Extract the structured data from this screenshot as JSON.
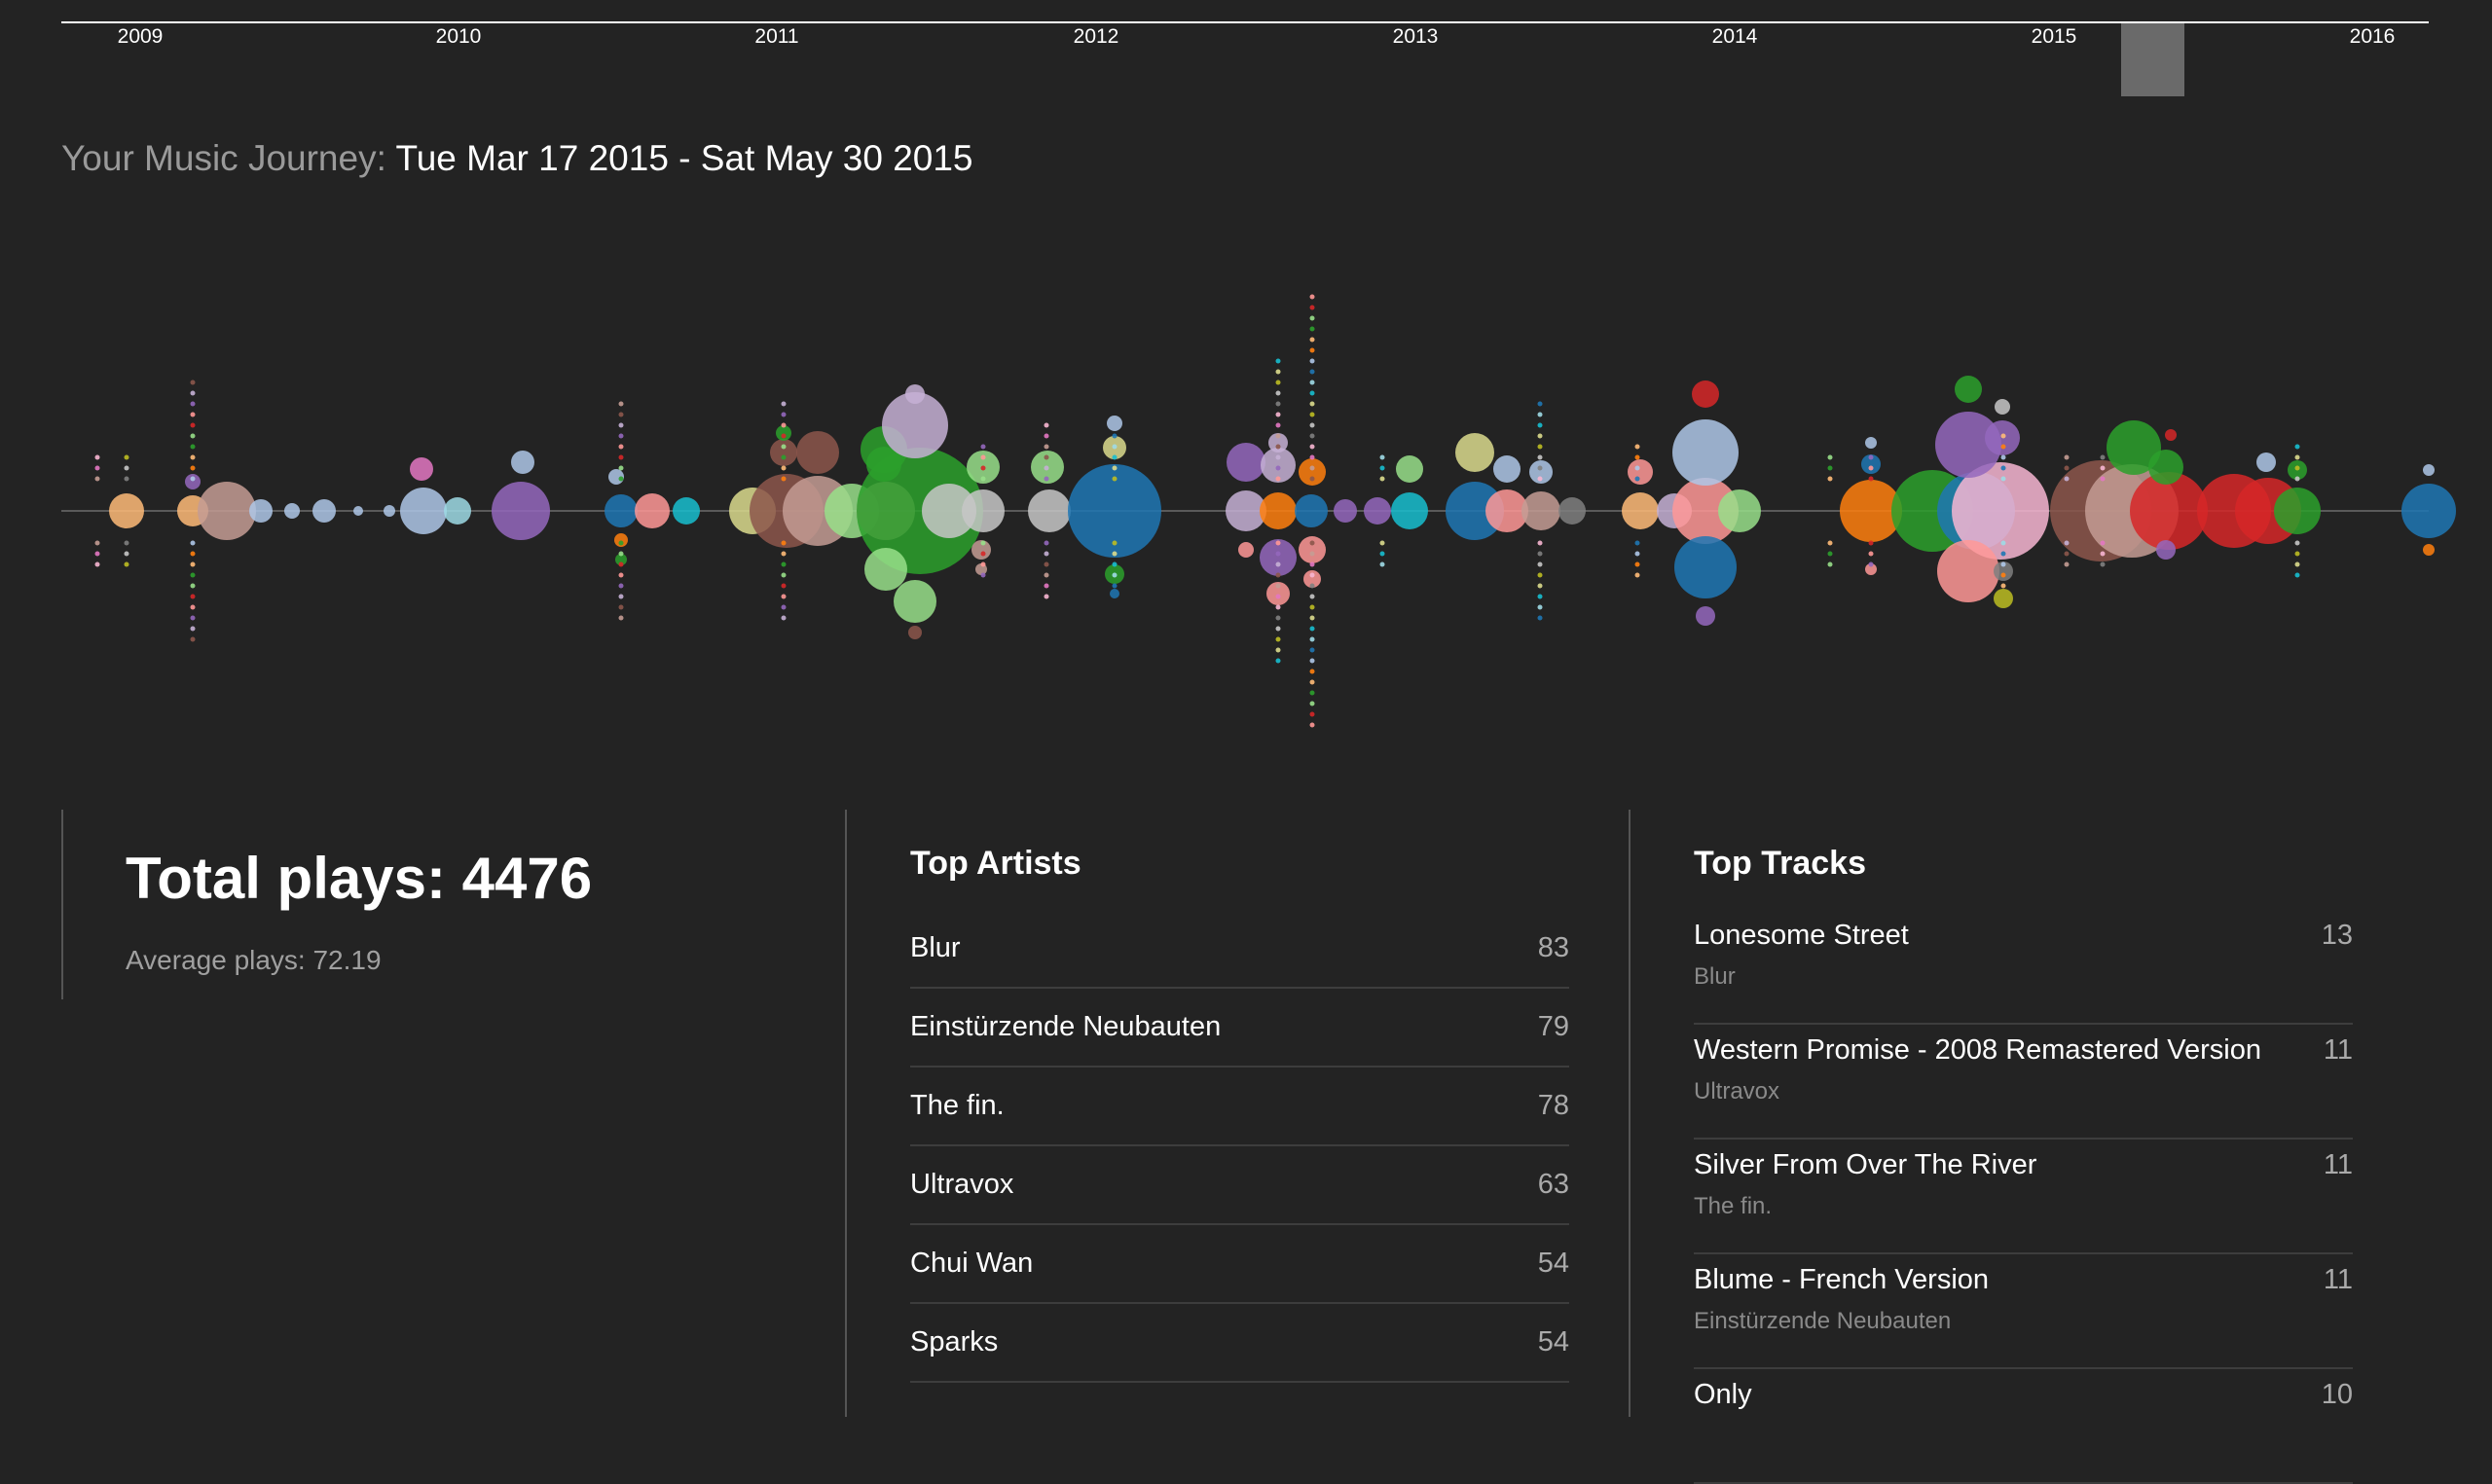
{
  "timeline": {
    "years": [
      "2009",
      "2010",
      "2011",
      "2012",
      "2013",
      "2014",
      "2015",
      "2016"
    ],
    "selection": {
      "start": "Tue Mar 17 2015",
      "end": "Sat May 30 2015"
    }
  },
  "journey": {
    "prefix": "Your Music Journey:",
    "range": "Tue Mar 17 2015 - Sat May 30 2015"
  },
  "totals": {
    "total_label": "Total plays: 4476",
    "average_label": "Average plays: 72.19"
  },
  "top_artists": {
    "title": "Top Artists",
    "items": [
      {
        "name": "Blur",
        "count": "83"
      },
      {
        "name": "Einstürzende Neubauten",
        "count": "79"
      },
      {
        "name": "The fin.",
        "count": "78"
      },
      {
        "name": "Ultravox",
        "count": "63"
      },
      {
        "name": "Chui Wan",
        "count": "54"
      },
      {
        "name": "Sparks",
        "count": "54"
      }
    ]
  },
  "top_tracks": {
    "title": "Top Tracks",
    "items": [
      {
        "title": "Lonesome Street",
        "artist": "Blur",
        "count": "13"
      },
      {
        "title": "Western Promise - 2008 Remastered Version",
        "artist": "Ultravox",
        "count": "11"
      },
      {
        "title": "Silver From Over The River",
        "artist": "The fin.",
        "count": "11"
      },
      {
        "title": "Blume - French Version",
        "artist": "Einstürzende Neubauten",
        "count": "11"
      },
      {
        "title": "Only",
        "artist": "",
        "count": "10"
      }
    ]
  },
  "colors": {
    "background": "#232323",
    "palette": [
      "#1f77b4",
      "#aec7e8",
      "#ff7f0e",
      "#ffbb78",
      "#2ca02c",
      "#98df8a",
      "#d62728",
      "#ff9896",
      "#9467bd",
      "#c5b0d5",
      "#8c564b",
      "#c49c94",
      "#e377c2",
      "#f7b6d2",
      "#7f7f7f",
      "#c7c7c7",
      "#bcbd22",
      "#dbdb8d",
      "#17becf",
      "#9edae5"
    ]
  }
}
